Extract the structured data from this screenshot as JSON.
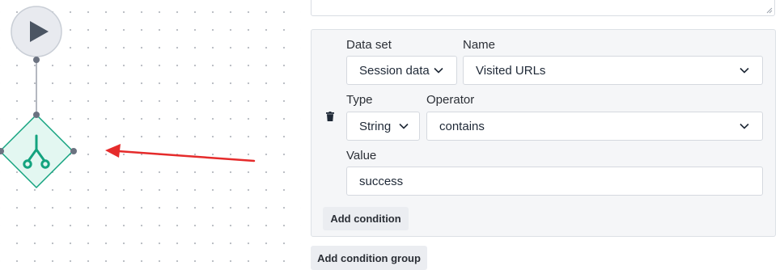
{
  "condition_group": {
    "dataset_label": "Data set",
    "name_label": "Name",
    "dataset_value": "Session data",
    "name_value": "Visited URLs",
    "type_label": "Type",
    "operator_label": "Operator",
    "type_value": "String",
    "operator_value": "contains",
    "value_label": "Value",
    "value_value": "success",
    "add_condition_label": "Add condition"
  },
  "add_group_label": "Add condition group",
  "icons": {
    "start_node": "play-icon",
    "split_node": "split-branch-icon",
    "delete": "trash-icon",
    "annotation": "red-arrow",
    "dropdown": "chevron-down-icon"
  },
  "colors": {
    "node_teal": "#14a37f",
    "node_fill": "#e3f7f1",
    "start_fill": "#e8eaef",
    "arrow_red": "#e52b2b"
  }
}
